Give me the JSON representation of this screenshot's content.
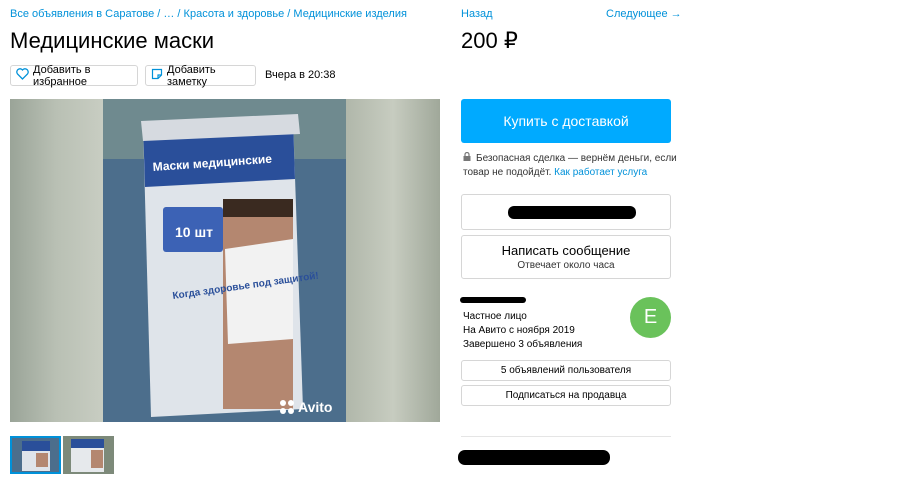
{
  "breadcrumb": {
    "item1": "Все объявления в Саратове",
    "sep1": " / ",
    "item2": "…",
    "sep2": " / ",
    "item3": "Красота и здоровье",
    "sep3": " / ",
    "item4": "Медицинские изделия"
  },
  "nav": {
    "back": "Назад",
    "next": "Следующее →"
  },
  "listing": {
    "title": "Медицинские маски",
    "price": "200 ₽",
    "add_favorite": "Добавить в избранное",
    "add_note": "Добавить заметку",
    "date": "Вчера в 20:38"
  },
  "photo": {
    "package_header": "Маски медицинские",
    "count": "10 шт",
    "slogan": "Когда здоровье под защитой!",
    "watermark": "Avito"
  },
  "sidebar": {
    "buy_label": "Купить с доставкой",
    "safe_deal_text": "Безопасная сделка — вернём деньги, если товар не подойдёт.",
    "safe_deal_link": "Как работает услуга",
    "message_label": "Написать сообщение",
    "message_sub": "Отвечает около часа"
  },
  "seller": {
    "type": "Частное лицо",
    "since": "На Авито с ноября 2019",
    "completed": "Завершено 3 объявления",
    "avatar_letter": "Е",
    "ads_button": "5 объявлений пользователя",
    "subscribe_button": "Подписаться на продавца"
  },
  "colors": {
    "accent": "#00aaff",
    "link": "#0091d9",
    "avatar": "#6ac25b"
  }
}
